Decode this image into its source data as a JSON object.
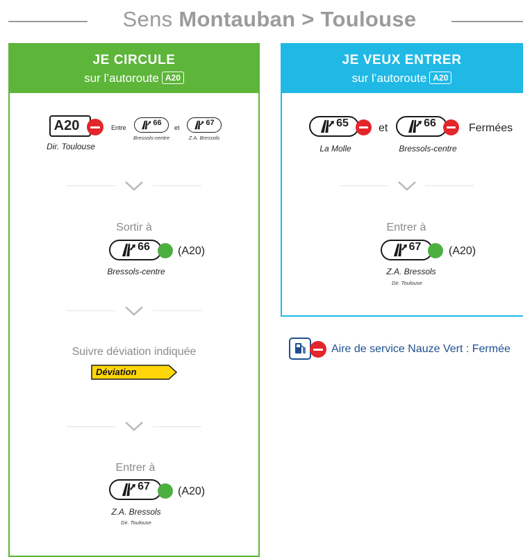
{
  "header": {
    "prefix": "Sens ",
    "direction": "Montauban > Toulouse"
  },
  "left_panel": {
    "title": "JE CIRCULE",
    "subtitle": "sur l’autoroute",
    "road": "A20",
    "closure": {
      "road": "A20",
      "direction": "Dir. Toulouse",
      "between_label": "Entre",
      "and_label": "et",
      "exit_from": {
        "number": "66",
        "name": "Bressols-centre"
      },
      "exit_to": {
        "number": "67",
        "name": "Z.A. Bressols"
      }
    },
    "step1": {
      "label": "Sortir à",
      "exit_number": "66",
      "road": "(A20)",
      "name": "Bressols-centre"
    },
    "step2": {
      "label": "Suivre déviation indiquée",
      "sign": "Déviation"
    },
    "step3": {
      "label": "Entrer à",
      "exit_number": "67",
      "road": "(A20)",
      "name": "Z.A. Bressols",
      "direction": "Dir. Toulouse"
    }
  },
  "right_panel": {
    "title": "JE VEUX ENTRER",
    "subtitle": "sur l’autoroute",
    "road": "A20",
    "closure": {
      "exit_a": {
        "number": "65",
        "name": "La Molle"
      },
      "and_label": "et",
      "exit_b": {
        "number": "66",
        "name": "Bressols-centre"
      },
      "status": "Fermées"
    },
    "step1": {
      "label": "Entrer à",
      "exit_number": "67",
      "road": "(A20)",
      "name": "Z.A. Bressols",
      "direction": "Dir. Toulouse"
    }
  },
  "service_area": {
    "text": "Aire de service Nauze Vert : Fermée"
  },
  "colors": {
    "left_accent": "#5db53a",
    "right_accent": "#20b9e6",
    "open": "#4caf3f",
    "closed": "#e3262b",
    "detour_sign": "#ffd60a",
    "service_text": "#1d4f91"
  }
}
